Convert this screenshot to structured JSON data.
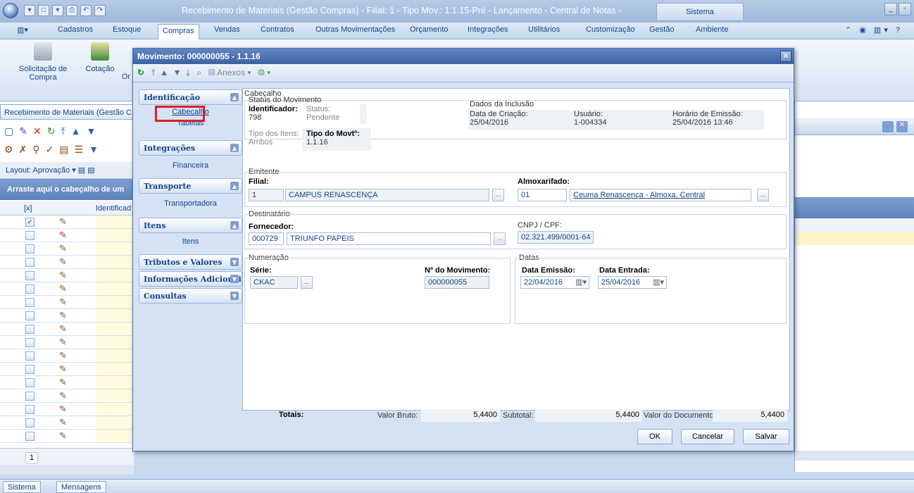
{
  "window": {
    "title": "Recebimento de Materiais (Gestão Compras) - Filial: 1 - Tipo Mov.: 1.1.15-Pré - Lançamento - Central de Notas -",
    "system_tab": "Sistema"
  },
  "menu": {
    "items": [
      "Cadastros",
      "Estoque",
      "Compras",
      "Vendas",
      "Contratos",
      "Outras Movimentações",
      "Orçamento",
      "Integrações",
      "Utilitários",
      "Customização",
      "Gestão",
      "Ambiente"
    ],
    "active": "Compras"
  },
  "ribbon": {
    "buttons": [
      "Solicitação de Compra",
      "Cotação",
      "Or"
    ]
  },
  "left": {
    "tab_title": "Recebimento de Materiais (Gestão C",
    "layout_label": "Layout:",
    "layout_value": "Aprovação",
    "group_header": "Arraste aqui o cabeçalho de um",
    "col_check": "[x]",
    "col_ident": "Identificad",
    "page_number": "1"
  },
  "dialog": {
    "title": "Movimento: 000000055 - 1.1.16",
    "anexos": "Anexos",
    "nav": {
      "identificacao": "Identificação",
      "cabecalho": "Cabecalho",
      "tabelas": "Tabelas",
      "integracoes": "Integrações",
      "financeira": "Financeira",
      "transporte": "Transporte",
      "transportadora": "Transportadora",
      "itens_group": "Itens",
      "itens": "Itens",
      "tributos": "Tributos e Valores",
      "info_adic": "Informações Adicionai",
      "consultas": "Consultas"
    },
    "cabecalho": {
      "section": "Cabeçalho",
      "status_do_movimento": "Status do Movimento",
      "identificador_label": "Identificador:",
      "identificador": "798",
      "status_label": "Status:",
      "status": "Pendente",
      "tipo_itens_label": "Tipo dos Itens:",
      "tipo_itens": "Ambos",
      "tipo_movto_label": "Tipo do Movtº:",
      "tipo_movto": "1.1.16",
      "dados_inclusao": "Dados da Inclusão",
      "data_criacao_label": "Data de Criação:",
      "data_criacao": "25/04/2016",
      "usuario_label": "Usuário:",
      "usuario": "1-004334",
      "horario_label": "Horário de Emissão:",
      "horario": "25/04/2016 13:46"
    },
    "emitente": {
      "section": "Emitente",
      "filial_label": "Filial:",
      "filial_code": "1",
      "filial_name": "CAMPUS RENASCENÇA",
      "almox_label": "Almoxarifado:",
      "almox_code": "01",
      "almox_name": "Ceuma Renascença - Almoxa. Central"
    },
    "destinatario": {
      "section": "Destinatário",
      "fornecedor_label": "Fornecedor:",
      "fornecedor_code": "000729",
      "fornecedor_name": "TRIUNFO PAPEIS",
      "cnpj_label": "CNPJ / CPF:",
      "cnpj": "02.321.499/0001-64"
    },
    "numeracao": {
      "section": "Numeração",
      "serie_label": "Série:",
      "serie": "CKAC",
      "num_mov_label": "Nº do Movimento:",
      "num_mov": "000000055"
    },
    "datas": {
      "section": "Datas",
      "emissao_label": "Data Emissão:",
      "emissao": "22/04/2016",
      "entrada_label": "Data Entrada:",
      "entrada": "25/04/2016"
    },
    "totais": {
      "label": "Totais:",
      "valor_bruto_label": "Valor Bruto:",
      "valor_bruto": "5,4400",
      "subtotal_label": "Subtotal: :",
      "subtotal": "5,4400",
      "valor_doc_label": "Valor do Documento:",
      "valor_doc": "5,4400"
    },
    "buttons": {
      "ok": "OK",
      "cancelar": "Cancelar",
      "salvar": "Salvar"
    }
  },
  "statusbar": {
    "sistema": "Sistema",
    "mensagens": "Mensagens"
  },
  "colors": {
    "highlight": "#e01b24",
    "title_blue": "#3d63a3"
  }
}
